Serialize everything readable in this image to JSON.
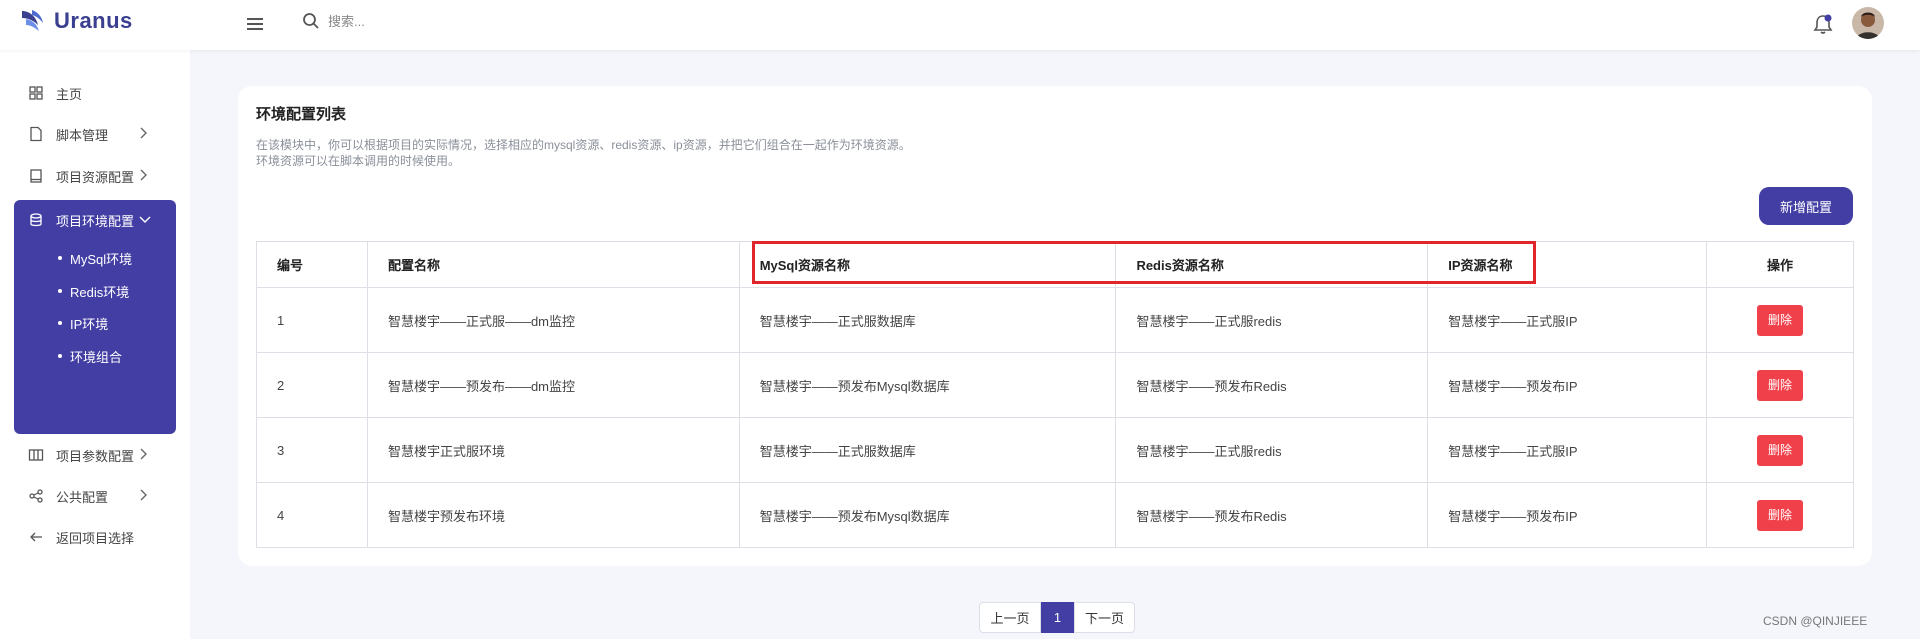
{
  "brand": {
    "name": "Uranus",
    "accent": "#433ea3"
  },
  "header": {
    "search_placeholder": "搜索...",
    "icons": [
      "menu-icon",
      "search-icon",
      "bell-icon",
      "avatar"
    ]
  },
  "sidebar": {
    "items": [
      {
        "label": "主页",
        "icon": "grid-icon"
      },
      {
        "label": "脚本管理",
        "icon": "file-icon"
      },
      {
        "label": "项目资源配置",
        "icon": "book-icon"
      },
      {
        "label": "项目环境配置",
        "icon": "database-icon"
      },
      {
        "label": "项目参数配置",
        "icon": "columns-icon"
      },
      {
        "label": "公共配置",
        "icon": "share-icon"
      },
      {
        "label": "返回项目选择",
        "icon": "arrow-left-icon"
      }
    ],
    "subitems": [
      "MySql环境",
      "Redis环境",
      "IP环境",
      "环境组合"
    ]
  },
  "main": {
    "title": "环境配置列表",
    "desc_line1": "在该模块中，你可以根据项目的实际情况，选择相应的mysql资源、redis资源、ip资源，并把它们组合在一起作为环境资源。",
    "desc_line2": "环境资源可以在脚本调用的时候使用。",
    "add_button": "新增配置",
    "table": {
      "headers": [
        "编号",
        "配置名称",
        "MySql资源名称",
        "Redis资源名称",
        "IP资源名称",
        "操作"
      ],
      "rows": [
        [
          "1",
          "智慧楼宇——正式服——dm监控",
          "智慧楼宇——正式服数据库",
          "智慧楼宇——正式服redis",
          "智慧楼宇——正式服IP",
          "删除"
        ],
        [
          "2",
          "智慧楼宇——预发布——dm监控",
          "智慧楼宇——预发布Mysql数据库",
          "智慧楼宇——预发布Redis",
          "智慧楼宇——预发布IP",
          "删除"
        ],
        [
          "3",
          "智慧楼宇正式服环境",
          "智慧楼宇——正式服数据库",
          "智慧楼宇——正式服redis",
          "智慧楼宇——正式服IP",
          "删除"
        ],
        [
          "4",
          "智慧楼宇预发布环境",
          "智慧楼宇——预发布Mysql数据库",
          "智慧楼宇——预发布Redis",
          "智慧楼宇——预发布IP",
          "删除"
        ]
      ]
    }
  },
  "pagination": {
    "prev": "上一页",
    "current": "1",
    "next": "下一页"
  },
  "watermark": "CSDN @QINJIEEE",
  "colors": {
    "primary": "#433ea3",
    "danger": "#f0414b",
    "annotation": "#e0262b"
  }
}
